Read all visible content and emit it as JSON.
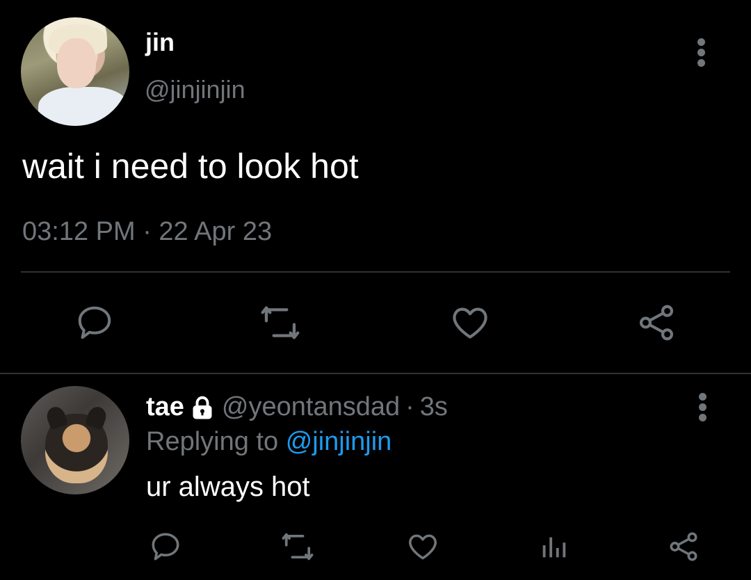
{
  "tweet": {
    "author_name": "jin",
    "author_handle": "@jinjinjin",
    "text": "wait i need to look hot",
    "timestamp": "03:12 PM · 22 Apr 23",
    "actions": [
      "reply-icon",
      "retweet-icon",
      "like-icon",
      "share-icon"
    ]
  },
  "reply": {
    "author_name": "tae",
    "author_handle": "@yeontansdad",
    "separator": "·",
    "time": "3s",
    "replying_label": "Replying to",
    "replying_to": "@jinjinjin",
    "text": "ur always hot",
    "actions": [
      "reply-icon",
      "retweet-icon",
      "like-icon",
      "analytics-icon",
      "share-icon"
    ]
  },
  "colors": {
    "background": "#000000",
    "primary_text": "#ffffff",
    "secondary_text": "#71767b",
    "mention": "#1d9bf0",
    "divider": "#2f3336"
  }
}
